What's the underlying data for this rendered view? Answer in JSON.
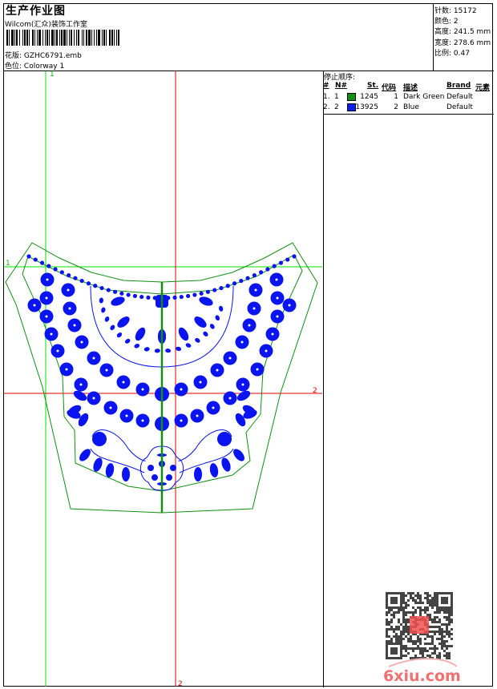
{
  "header": {
    "title": "生产作业图",
    "studio": "Wilcom(汇众)装饰工作室",
    "design_label": "花版:",
    "design_value": "GZHC6791.emb",
    "colorway_label": "色位:",
    "colorway_value": "Colorway 1"
  },
  "info": {
    "stitches_label": "针数:",
    "stitches_value": "15172",
    "colors_label": "颜色:",
    "colors_value": "2",
    "height_label": "高度:",
    "height_value": "241.5 mm",
    "width_label": "宽度:",
    "width_value": "278.6 mm",
    "scale_label": "比例:",
    "scale_value": "0.47"
  },
  "stop_sequence": {
    "title": "停止顺序:",
    "columns": [
      "#",
      "N#",
      "St.",
      "代码",
      "描述",
      "Brand",
      "元素"
    ],
    "rows": [
      {
        "idx": "1.",
        "n": "1",
        "color": "#109010",
        "stitches": "1245",
        "code": "1",
        "desc": "Dark Green",
        "brand": "Default",
        "element": ""
      },
      {
        "idx": "2.",
        "n": "2",
        "color": "#0a1ef0",
        "stitches": "13925",
        "code": "2",
        "desc": "Blue",
        "brand": "Default",
        "element": ""
      }
    ]
  },
  "grid_labels": {
    "green_top": "1",
    "green_left": "1",
    "red_right": "2",
    "red_bottom": "2"
  },
  "colors": {
    "grid_green": "#00e000",
    "grid_red": "#e00000",
    "outline_green": "#109010",
    "stitch_blue": "#0a14f0"
  },
  "watermark": {
    "text": "6xiu.com",
    "seal": "以图版"
  }
}
